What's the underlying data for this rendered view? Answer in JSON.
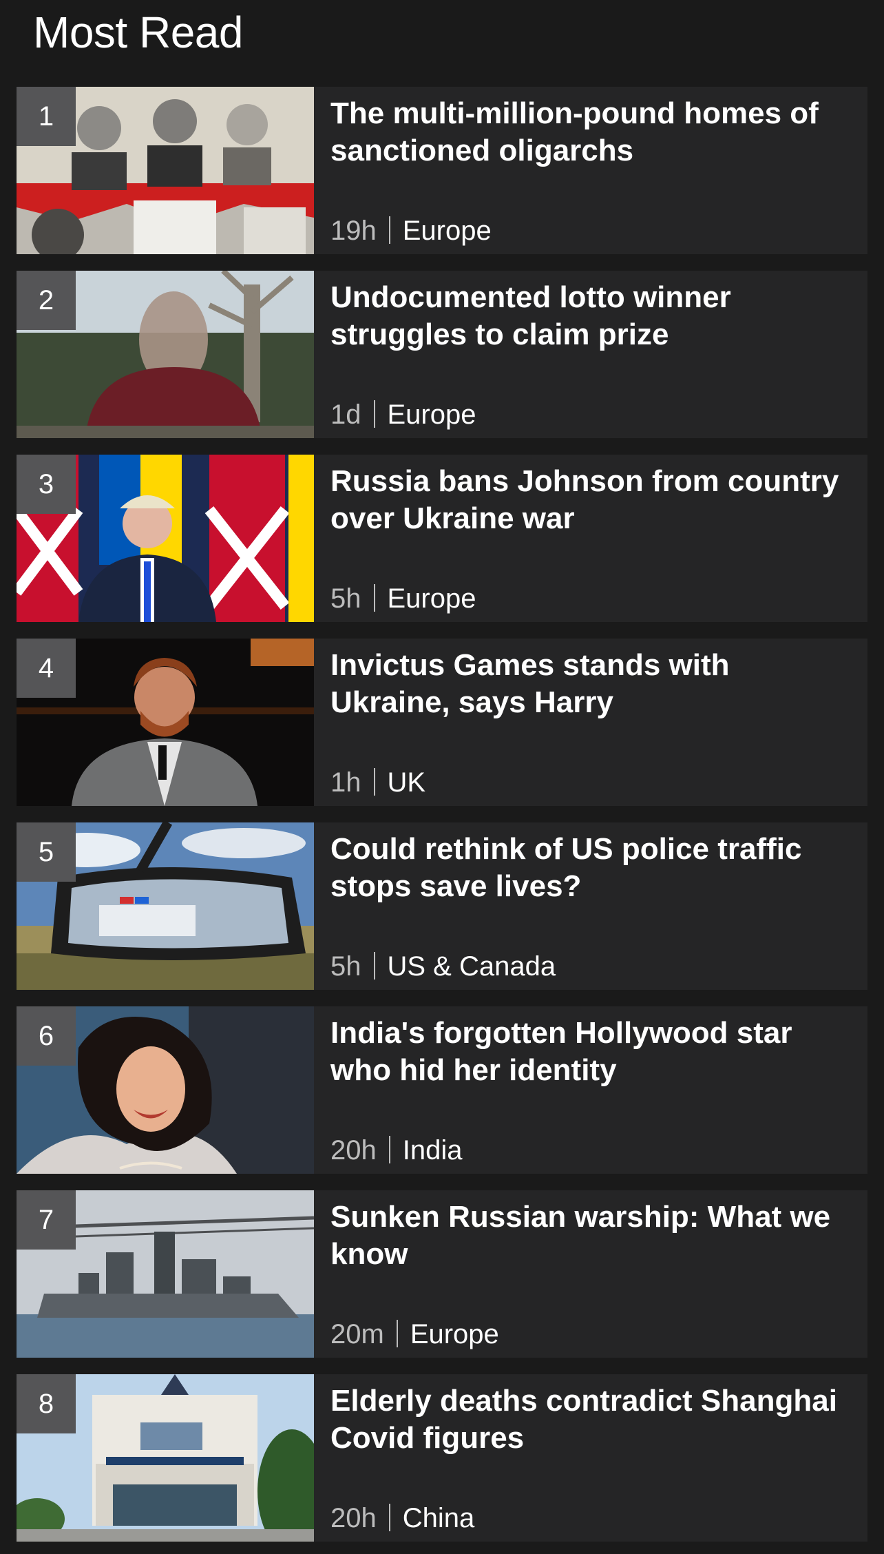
{
  "section": {
    "title": "Most Read"
  },
  "items": [
    {
      "rank": "1",
      "headline": "The multi-million-pound homes of sanctioned oligarchs",
      "time": "19h",
      "category": "Europe"
    },
    {
      "rank": "2",
      "headline": "Undocumented lotto winner struggles to claim prize",
      "time": "1d",
      "category": "Europe"
    },
    {
      "rank": "3",
      "headline": "Russia bans Johnson from country over Ukraine war",
      "time": "5h",
      "category": "Europe"
    },
    {
      "rank": "4",
      "headline": "Invictus Games stands with Ukraine, says Harry",
      "time": "1h",
      "category": "UK"
    },
    {
      "rank": "5",
      "headline": "Could rethink of US police traffic stops save lives?",
      "time": "5h",
      "category": "US & Canada"
    },
    {
      "rank": "6",
      "headline": "India's forgotten Hollywood star who hid her identity",
      "time": "20h",
      "category": "India"
    },
    {
      "rank": "7",
      "headline": "Sunken Russian warship: What we know",
      "time": "20m",
      "category": "Europe"
    },
    {
      "rank": "8",
      "headline": "Elderly deaths contradict Shanghai Covid figures",
      "time": "20h",
      "category": "China"
    }
  ]
}
